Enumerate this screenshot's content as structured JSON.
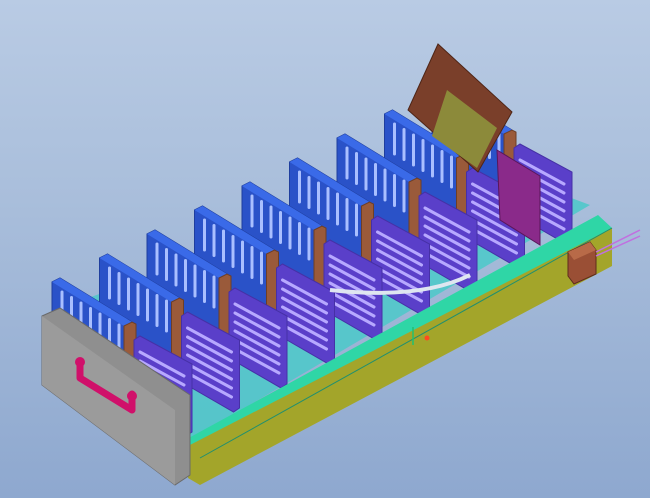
{
  "viewport": {
    "background_top": "#b9cbe4",
    "background_bottom": "#8ea8cf"
  },
  "model": {
    "slot_count": 9,
    "colors": {
      "blue_plate": "#2a52c8",
      "blue_plate_dark": "#1f3e9e",
      "purple_plate": "#5a3fc9",
      "purple_plate_dark": "#4630a6",
      "spacer": "#9a5a3a",
      "rail_top": "#2fd6a6",
      "rail_side": "#a3a52a",
      "end_panel": "#8f8f8f",
      "handle": "#d0106a",
      "connector": "#9a4f35",
      "brown_sheet": "#7a3f2a",
      "olive_sheet": "#8c8a3a",
      "magenta_sheet": "#8a2a8a"
    }
  }
}
